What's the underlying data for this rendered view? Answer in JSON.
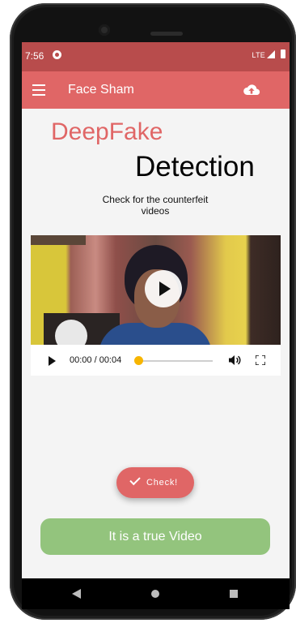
{
  "status_bar": {
    "time": "7:56",
    "network": "LTE"
  },
  "app_bar": {
    "title": "Face Sham",
    "menu_icon": "hamburger-menu-icon",
    "action_icon": "cloud-upload-icon"
  },
  "hero": {
    "line1": "DeepFake",
    "line2": "Detection",
    "subtitle_line1": "Check for the counterfeit",
    "subtitle_line2": "videos"
  },
  "video_player": {
    "time": "00:00 / 00:04",
    "progress": 0.0
  },
  "check_button": {
    "label": "Check!"
  },
  "result": {
    "text": "It is a true Video"
  },
  "colors": {
    "status_bar": "#b84c4c",
    "app_bar": "#e06666",
    "accent": "#e06666",
    "result_success": "#93c47d",
    "progress": "#f7b500"
  }
}
